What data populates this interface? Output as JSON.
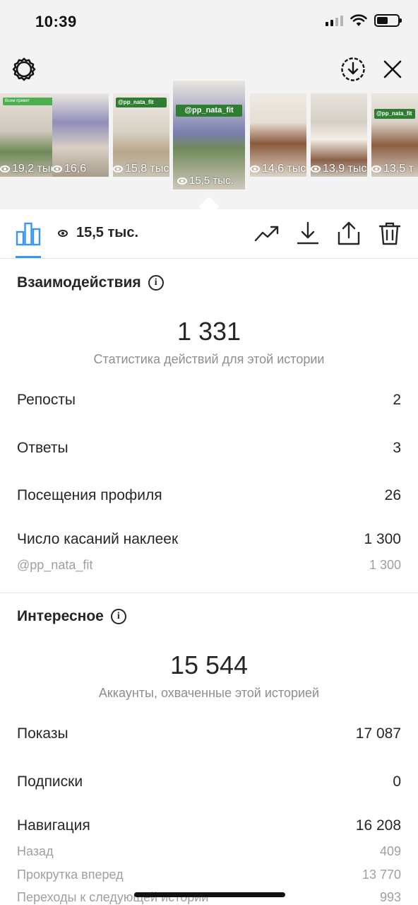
{
  "status_bar": {
    "time": "10:39"
  },
  "stories": [
    {
      "views": "19,2 тыс.",
      "tag": "Всем привет"
    },
    {
      "views": "16,6",
      "tag": ""
    },
    {
      "views": "15,8 тыс.",
      "tag": "@pp_nata_fit"
    },
    {
      "views": "15,5 тыс.",
      "tag": "@pp_nata_fit"
    },
    {
      "views": "14,6 тыс.",
      "tag": ""
    },
    {
      "views": "13,9 тыс.",
      "tag": ""
    },
    {
      "views": "13,5 т",
      "tag": "@pp_nata_fit"
    }
  ],
  "tab_bar": {
    "view_count": "15,5 тыс."
  },
  "interactions": {
    "title": "Взаимодействия",
    "total": "1 331",
    "caption": "Статистика действий для этой истории",
    "rows": [
      {
        "label": "Репосты",
        "value": "2"
      },
      {
        "label": "Ответы",
        "value": "3"
      },
      {
        "label": "Посещения профиля",
        "value": "26"
      },
      {
        "label": "Число касаний наклеек",
        "value": "1 300"
      }
    ],
    "sub_rows": [
      {
        "label": "@pp_nata_fit",
        "value": "1 300"
      }
    ]
  },
  "discovery": {
    "title": "Интересное",
    "total": "15 544",
    "caption": "Аккаунты, охваченные этой историей",
    "rows": [
      {
        "label": "Показы",
        "value": "17 087"
      },
      {
        "label": "Подписки",
        "value": "0"
      },
      {
        "label": "Навигация",
        "value": "16 208"
      }
    ],
    "sub_rows": [
      {
        "label": "Назад",
        "value": "409"
      },
      {
        "label": "Прокрутка вперед",
        "value": "13 770"
      },
      {
        "label": "Переходы к следующей истории",
        "value": "993"
      }
    ]
  },
  "colors": {
    "accent": "#3897f0",
    "story_tag": "#4caf50",
    "panel_bg": "#f3f3f3"
  }
}
